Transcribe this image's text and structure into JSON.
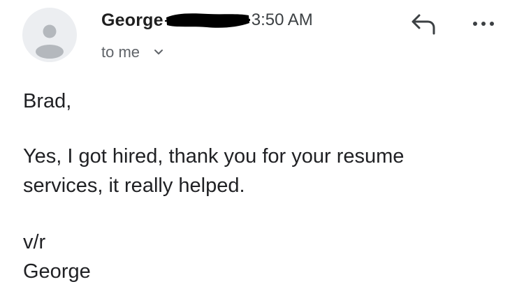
{
  "header": {
    "sender_name": "George",
    "time": "3:50 AM",
    "recipient": "to me",
    "avatar_icon": "person-icon",
    "reply_icon": "reply-icon",
    "more_icon": "more-options-icon",
    "expand_icon": "chevron-down-icon"
  },
  "message": {
    "greeting": "Brad,",
    "body_lines": [
      "Yes, I got hired, thank you for your resume",
      "services, it really helped."
    ],
    "signoff": "v/r",
    "signature": "George"
  },
  "colors": {
    "avatar_bg": "#eceef1",
    "avatar_fg": "#b4b8bd",
    "redaction": "#000000",
    "secondary_text": "#5f6368"
  }
}
